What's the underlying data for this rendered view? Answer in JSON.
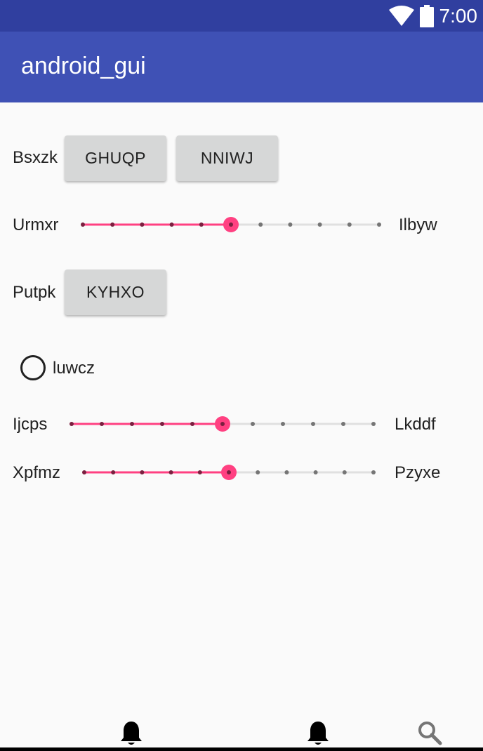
{
  "status_bar": {
    "time": "7:00",
    "icons": [
      "wifi-icon",
      "battery-icon"
    ]
  },
  "app_bar": {
    "title": "android_gui"
  },
  "rows": {
    "row1": {
      "label": "Bsxzk",
      "buttons": [
        "GHUQP",
        "NNIWJ"
      ]
    },
    "slider1": {
      "left_label": "Urmxr",
      "right_label": "Ilbyw",
      "value": 5,
      "max": 10
    },
    "row2": {
      "label": "Putpk",
      "button": "KYHXO"
    },
    "radio": {
      "label": "luwcz",
      "checked": false
    },
    "slider2": {
      "left_label": "Ijcps",
      "right_label": "Lkddf",
      "value": 5,
      "max": 10
    },
    "slider3": {
      "left_label": "Xpfmz",
      "right_label": "Pzyxe",
      "value": 5,
      "max": 10
    }
  },
  "bottom_nav": {
    "icons": [
      "bell-icon",
      "bell-icon",
      "search-icon"
    ]
  },
  "colors": {
    "status_bar": "#303f9f",
    "app_bar": "#3f51b5",
    "accent": "#ff4081",
    "button_bg": "#d6d7d7",
    "background": "#fafafa"
  }
}
